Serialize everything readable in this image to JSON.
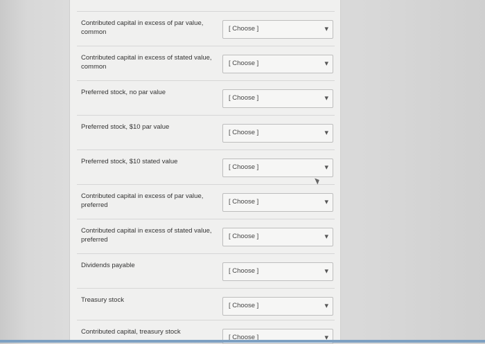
{
  "rows": [
    {
      "label_line1": "Contributed capital in excess of par value,",
      "label_line2": "common",
      "select": "[ Choose ]"
    },
    {
      "label_line1": "Contributed capital in excess of stated value,",
      "label_line2": "common",
      "select": "[ Choose ]"
    },
    {
      "label_line1": "Preferred stock, no par value",
      "label_line2": "",
      "select": "[ Choose ]"
    },
    {
      "label_line1": "Preferred stock, $10 par value",
      "label_line2": "",
      "select": "[ Choose ]"
    },
    {
      "label_line1": "Preferred stock, $10 stated value",
      "label_line2": "",
      "select": "[ Choose ]"
    },
    {
      "label_line1": "Contributed capital in excess of par value,",
      "label_line2": "preferred",
      "select": "[ Choose ]"
    },
    {
      "label_line1": "Contributed capital in excess of stated value,",
      "label_line2": "preferred",
      "select": "[ Choose ]"
    },
    {
      "label_line1": "Dividends payable",
      "label_line2": "",
      "select": "[ Choose ]"
    },
    {
      "label_line1": "Treasury stock",
      "label_line2": "",
      "select": "[ Choose ]"
    },
    {
      "label_line1": "Contributed capital, treasury stock",
      "label_line2": "",
      "select": "[ Choose ]"
    }
  ],
  "icons": {
    "dropdown": "chevron-down-icon",
    "cursor": "mouse-pointer-icon"
  }
}
